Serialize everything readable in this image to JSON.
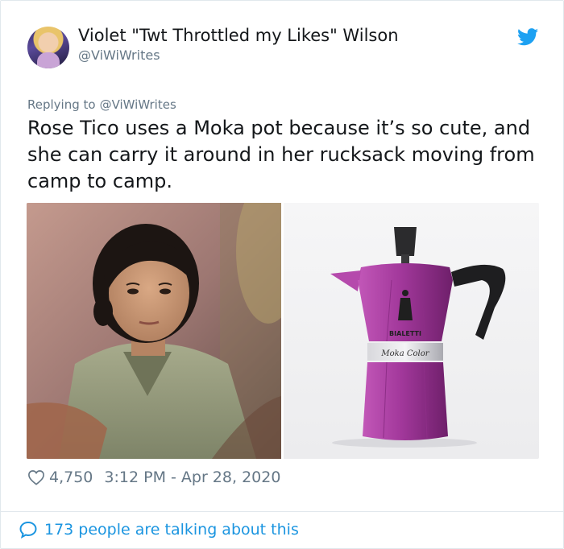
{
  "tweet": {
    "author_name": "Violet \"Twt Throttled my Likes\" Wilson",
    "author_handle": "@ViWiWrites",
    "reply_label": "Replying to",
    "reply_handle": "@ViWiWrites",
    "text": "Rose Tico uses a Moka pot because it’s so cute, and she can carry it around in her rucksack moving from camp to camp.",
    "likes": "4,750",
    "timestamp": "3:12 PM - Apr 28, 2020",
    "talking": "173 people are talking about this"
  },
  "media": {
    "pot_brand": "BIALETTI",
    "pot_model": "Moka Color"
  },
  "colors": {
    "twitter_blue": "#1da1f2",
    "link_blue": "#1b95e0",
    "muted_text": "#657786",
    "pot_purple": "#a2389b"
  },
  "icons": [
    "twitter-bird-icon",
    "heart-icon",
    "speech-bubble-icon"
  ]
}
